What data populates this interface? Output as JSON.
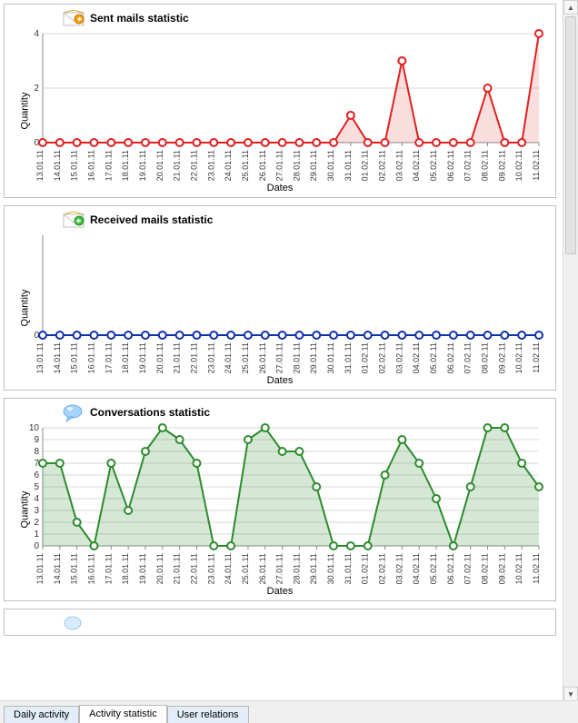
{
  "dates": [
    "13.01.11",
    "14.01.11",
    "15.01.11",
    "16.01.11",
    "17.01.11",
    "18.01.11",
    "19.01.11",
    "20.01.11",
    "21.01.11",
    "22.01.11",
    "23.01.11",
    "24.01.11",
    "25.01.11",
    "26.01.11",
    "27.01.11",
    "28.01.11",
    "29.01.11",
    "30.01.11",
    "31.01.11",
    "01.02.11",
    "02.02.11",
    "03.02.11",
    "04.02.11",
    "05.02.11",
    "06.02.11",
    "07.02.11",
    "08.02.11",
    "09.02.11",
    "10.02.11",
    "11.02.11"
  ],
  "panels": {
    "sent": {
      "title": "Sent mails statistic",
      "ylabel": "Quantity",
      "xlabel": "Dates"
    },
    "received": {
      "title": "Received mails statistic",
      "ylabel": "Quantity",
      "xlabel": "Dates"
    },
    "conv": {
      "title": "Conversations statistic",
      "ylabel": "Quantity",
      "xlabel": "Dates"
    }
  },
  "tabs": [
    "Daily activity",
    "Activity statistic",
    "User relations"
  ],
  "active_tab": 1,
  "chart_data": [
    {
      "id": "sent",
      "type": "line",
      "title": "Sent mails statistic",
      "xlabel": "Dates",
      "ylabel": "Quantity",
      "ylim": [
        0,
        4
      ],
      "yticks": [
        0,
        2,
        4
      ],
      "color": "#e02020",
      "fill": "rgba(224,32,32,0.15)",
      "categories": [
        "13.01.11",
        "14.01.11",
        "15.01.11",
        "16.01.11",
        "17.01.11",
        "18.01.11",
        "19.01.11",
        "20.01.11",
        "21.01.11",
        "22.01.11",
        "23.01.11",
        "24.01.11",
        "25.01.11",
        "26.01.11",
        "27.01.11",
        "28.01.11",
        "29.01.11",
        "30.01.11",
        "31.01.11",
        "01.02.11",
        "02.02.11",
        "03.02.11",
        "04.02.11",
        "05.02.11",
        "06.02.11",
        "07.02.11",
        "08.02.11",
        "09.02.11",
        "10.02.11",
        "11.02.11"
      ],
      "values": [
        0,
        0,
        0,
        0,
        0,
        0,
        0,
        0,
        0,
        0,
        0,
        0,
        0,
        0,
        0,
        0,
        0,
        0,
        1,
        0,
        0,
        3,
        0,
        0,
        0,
        0,
        2,
        0,
        0,
        4
      ]
    },
    {
      "id": "received",
      "type": "line",
      "title": "Received mails statistic",
      "xlabel": "Dates",
      "ylabel": "Quantity",
      "ylim": [
        0,
        0
      ],
      "yticks": [
        0
      ],
      "color": "#1030b0",
      "fill": "none",
      "categories": [
        "13.01.11",
        "14.01.11",
        "15.01.11",
        "16.01.11",
        "17.01.11",
        "18.01.11",
        "19.01.11",
        "20.01.11",
        "21.01.11",
        "22.01.11",
        "23.01.11",
        "24.01.11",
        "25.01.11",
        "26.01.11",
        "27.01.11",
        "28.01.11",
        "29.01.11",
        "30.01.11",
        "31.01.11",
        "01.02.11",
        "02.02.11",
        "03.02.11",
        "04.02.11",
        "05.02.11",
        "06.02.11",
        "07.02.11",
        "08.02.11",
        "09.02.11",
        "10.02.11",
        "11.02.11"
      ],
      "values": [
        0,
        0,
        0,
        0,
        0,
        0,
        0,
        0,
        0,
        0,
        0,
        0,
        0,
        0,
        0,
        0,
        0,
        0,
        0,
        0,
        0,
        0,
        0,
        0,
        0,
        0,
        0,
        0,
        0,
        0
      ]
    },
    {
      "id": "conv",
      "type": "line",
      "title": "Conversations statistic",
      "xlabel": "Dates",
      "ylabel": "Quantity",
      "ylim": [
        0,
        10
      ],
      "yticks": [
        0,
        1,
        2,
        3,
        4,
        5,
        6,
        7,
        8,
        9,
        10
      ],
      "color": "#2e8b2e",
      "fill": "rgba(46,139,46,0.2)",
      "categories": [
        "13.01.11",
        "14.01.11",
        "15.01.11",
        "16.01.11",
        "17.01.11",
        "18.01.11",
        "19.01.11",
        "20.01.11",
        "21.01.11",
        "22.01.11",
        "23.01.11",
        "24.01.11",
        "25.01.11",
        "26.01.11",
        "27.01.11",
        "28.01.11",
        "29.01.11",
        "30.01.11",
        "31.01.11",
        "01.02.11",
        "02.02.11",
        "03.02.11",
        "04.02.11",
        "05.02.11",
        "06.02.11",
        "07.02.11",
        "08.02.11",
        "09.02.11",
        "10.02.11",
        "11.02.11"
      ],
      "values": [
        7,
        7,
        2,
        0,
        7,
        3,
        8,
        10,
        9,
        7,
        0,
        0,
        9,
        10,
        8,
        8,
        5,
        0,
        0,
        0,
        6,
        9,
        7,
        4,
        0,
        5,
        10,
        10,
        7,
        5
      ]
    }
  ]
}
